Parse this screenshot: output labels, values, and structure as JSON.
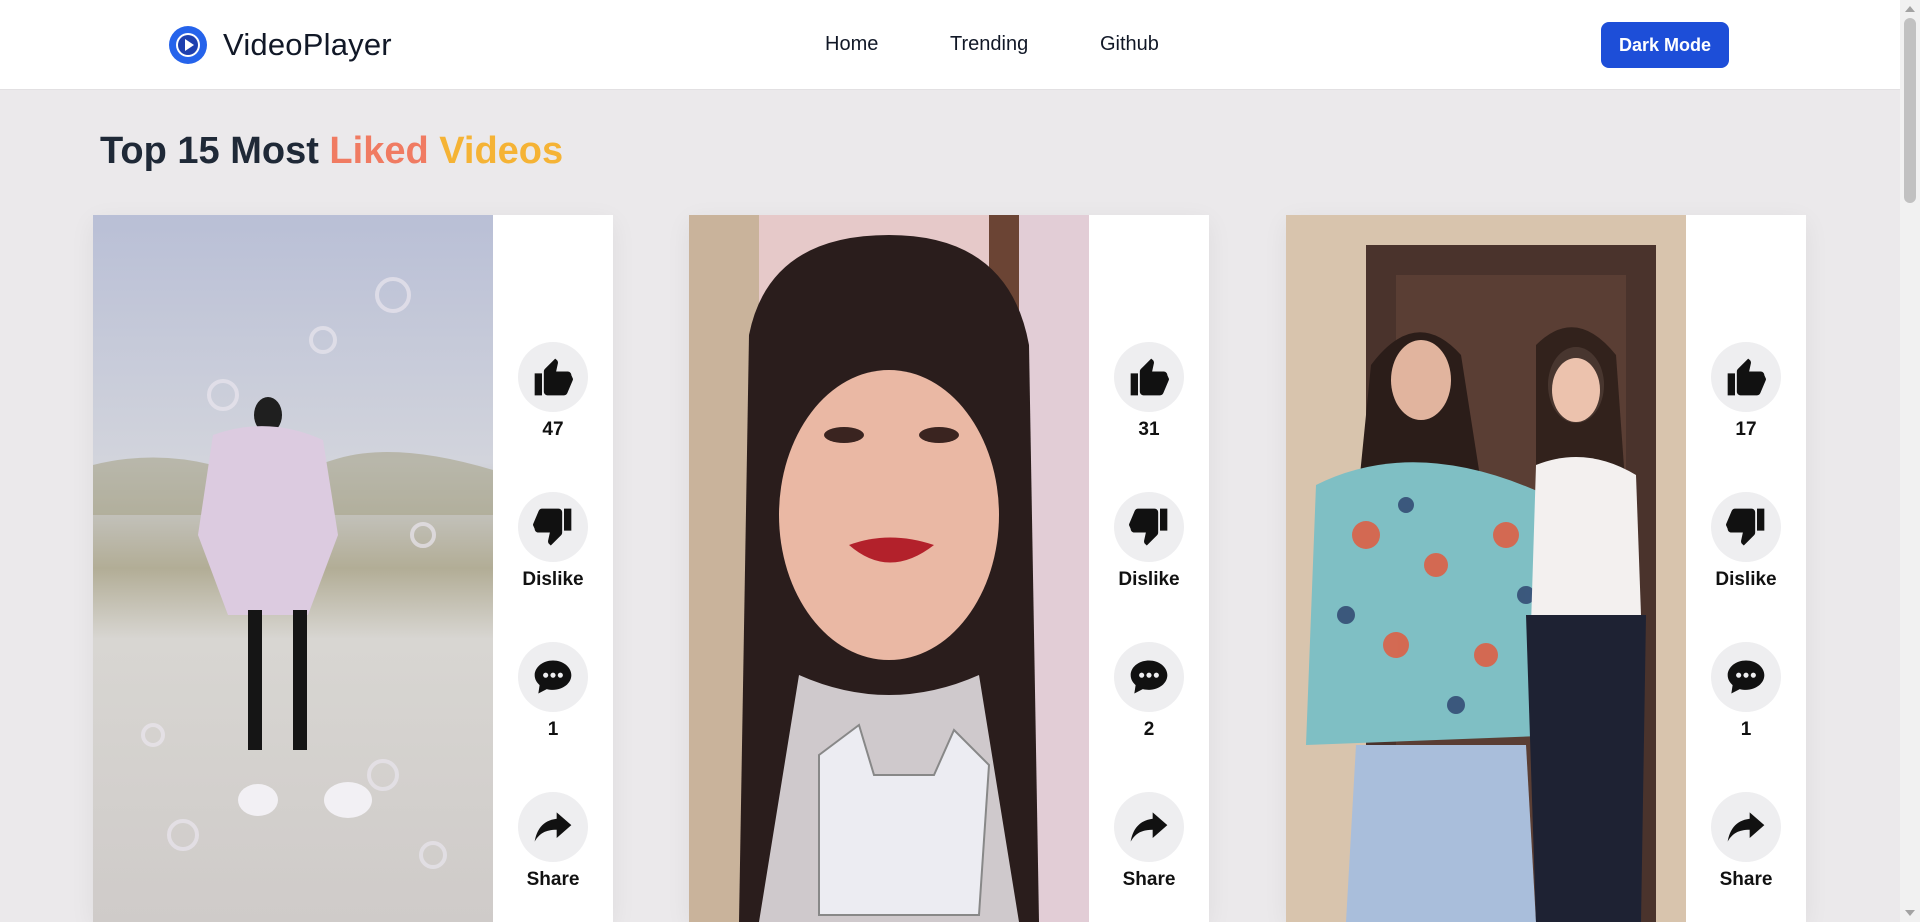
{
  "header": {
    "brand": "VideoPlayer",
    "nav": [
      "Home",
      "Trending",
      "Github"
    ],
    "dark_mode_label": "Dark Mode"
  },
  "page": {
    "heading_prefix": "Top 15 Most ",
    "heading_highlight_1": "Liked",
    "heading_highlight_2": "Videos"
  },
  "videos": [
    {
      "likes": "47",
      "dislike_label": "Dislike",
      "comments": "1",
      "share_label": "Share"
    },
    {
      "likes": "31",
      "dislike_label": "Dislike",
      "comments": "2",
      "share_label": "Share"
    },
    {
      "likes": "17",
      "dislike_label": "Dislike",
      "comments": "1",
      "share_label": "Share"
    }
  ],
  "colors": {
    "accent": "#1d4ed8",
    "highlight_1": "#f07b62",
    "highlight_2": "#f5b335",
    "background": "#ebe9eb"
  },
  "icons": [
    "play-logo-icon",
    "thumbs-up-icon",
    "thumbs-down-icon",
    "comment-icon",
    "share-icon"
  ]
}
